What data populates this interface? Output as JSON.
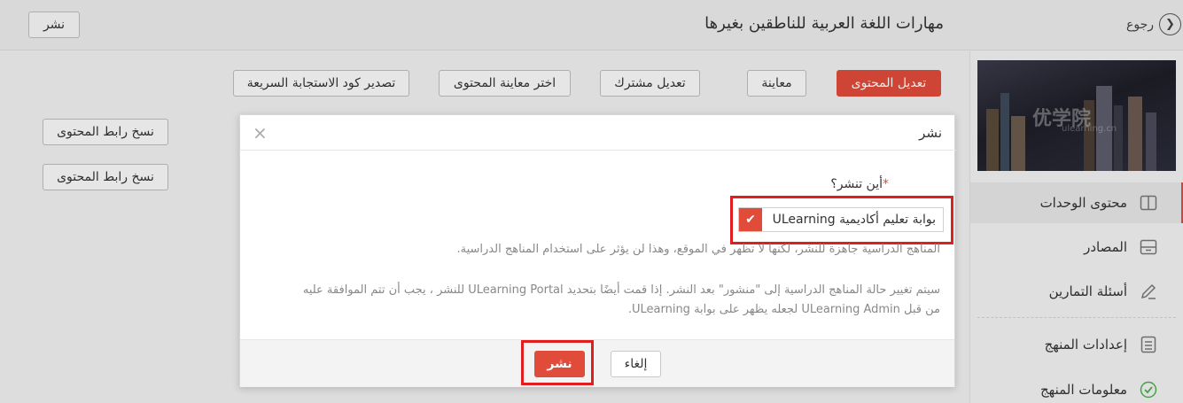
{
  "header": {
    "publish_label": "نشر",
    "title": "مهارات اللغة العربية للناطقين بغيرها",
    "back_label": "رجوع"
  },
  "toolbar": {
    "edit_content": "تعديل المحتوى",
    "preview": "معاينة",
    "co_edit": "تعديل مشترك",
    "test_preview": "اختر معاينة المحتوى",
    "export_qr": "تصدير كود الاستجابة السريعة",
    "copy_link_1": "نسخ رابط المحتوى",
    "copy_link_2": "نسخ رابط المحتوى"
  },
  "sidebar": {
    "thumbnail_logo": "优学院",
    "thumbnail_logo_sub": "ulearning.cn",
    "items": [
      {
        "label": "محتوى الوحدات",
        "icon": "book-icon"
      },
      {
        "label": "المصادر",
        "icon": "archive-icon"
      },
      {
        "label": "أسئلة التمارين",
        "icon": "pencil-icon"
      },
      {
        "label": "إعدادات المنهج",
        "icon": "settings-list-icon"
      },
      {
        "label": "معلومات المنهج",
        "icon": "check-circle-icon"
      }
    ]
  },
  "modal": {
    "title": "نشر",
    "close": "×",
    "field_label": "أين تنشر؟",
    "required_mark": "*",
    "option_label": "بوابة تعليم أكاديمية ULearning",
    "option_checked": true,
    "hint_1": "المناهج الدراسية جاهزة للنشر، لكنها لا تظهر في الموقع، وهذا لن يؤثر على استخدام المناهج الدراسية.",
    "hint_2_line1": "سيتم تغيير حالة المناهج الدراسية إلى \"منشور\" بعد النشر. إذا قمت أيضًا بتحديد ULearning Portal للنشر ، يجب أن تتم الموافقة عليه",
    "hint_2_line2": "من قبل ULearning Admin لجعله يظهر على بوابة ULearning.",
    "publish_button": "نشر",
    "cancel_button": "إلغاء"
  },
  "colors": {
    "accent": "#e04b3a",
    "highlight_box": "#e01e1e"
  }
}
